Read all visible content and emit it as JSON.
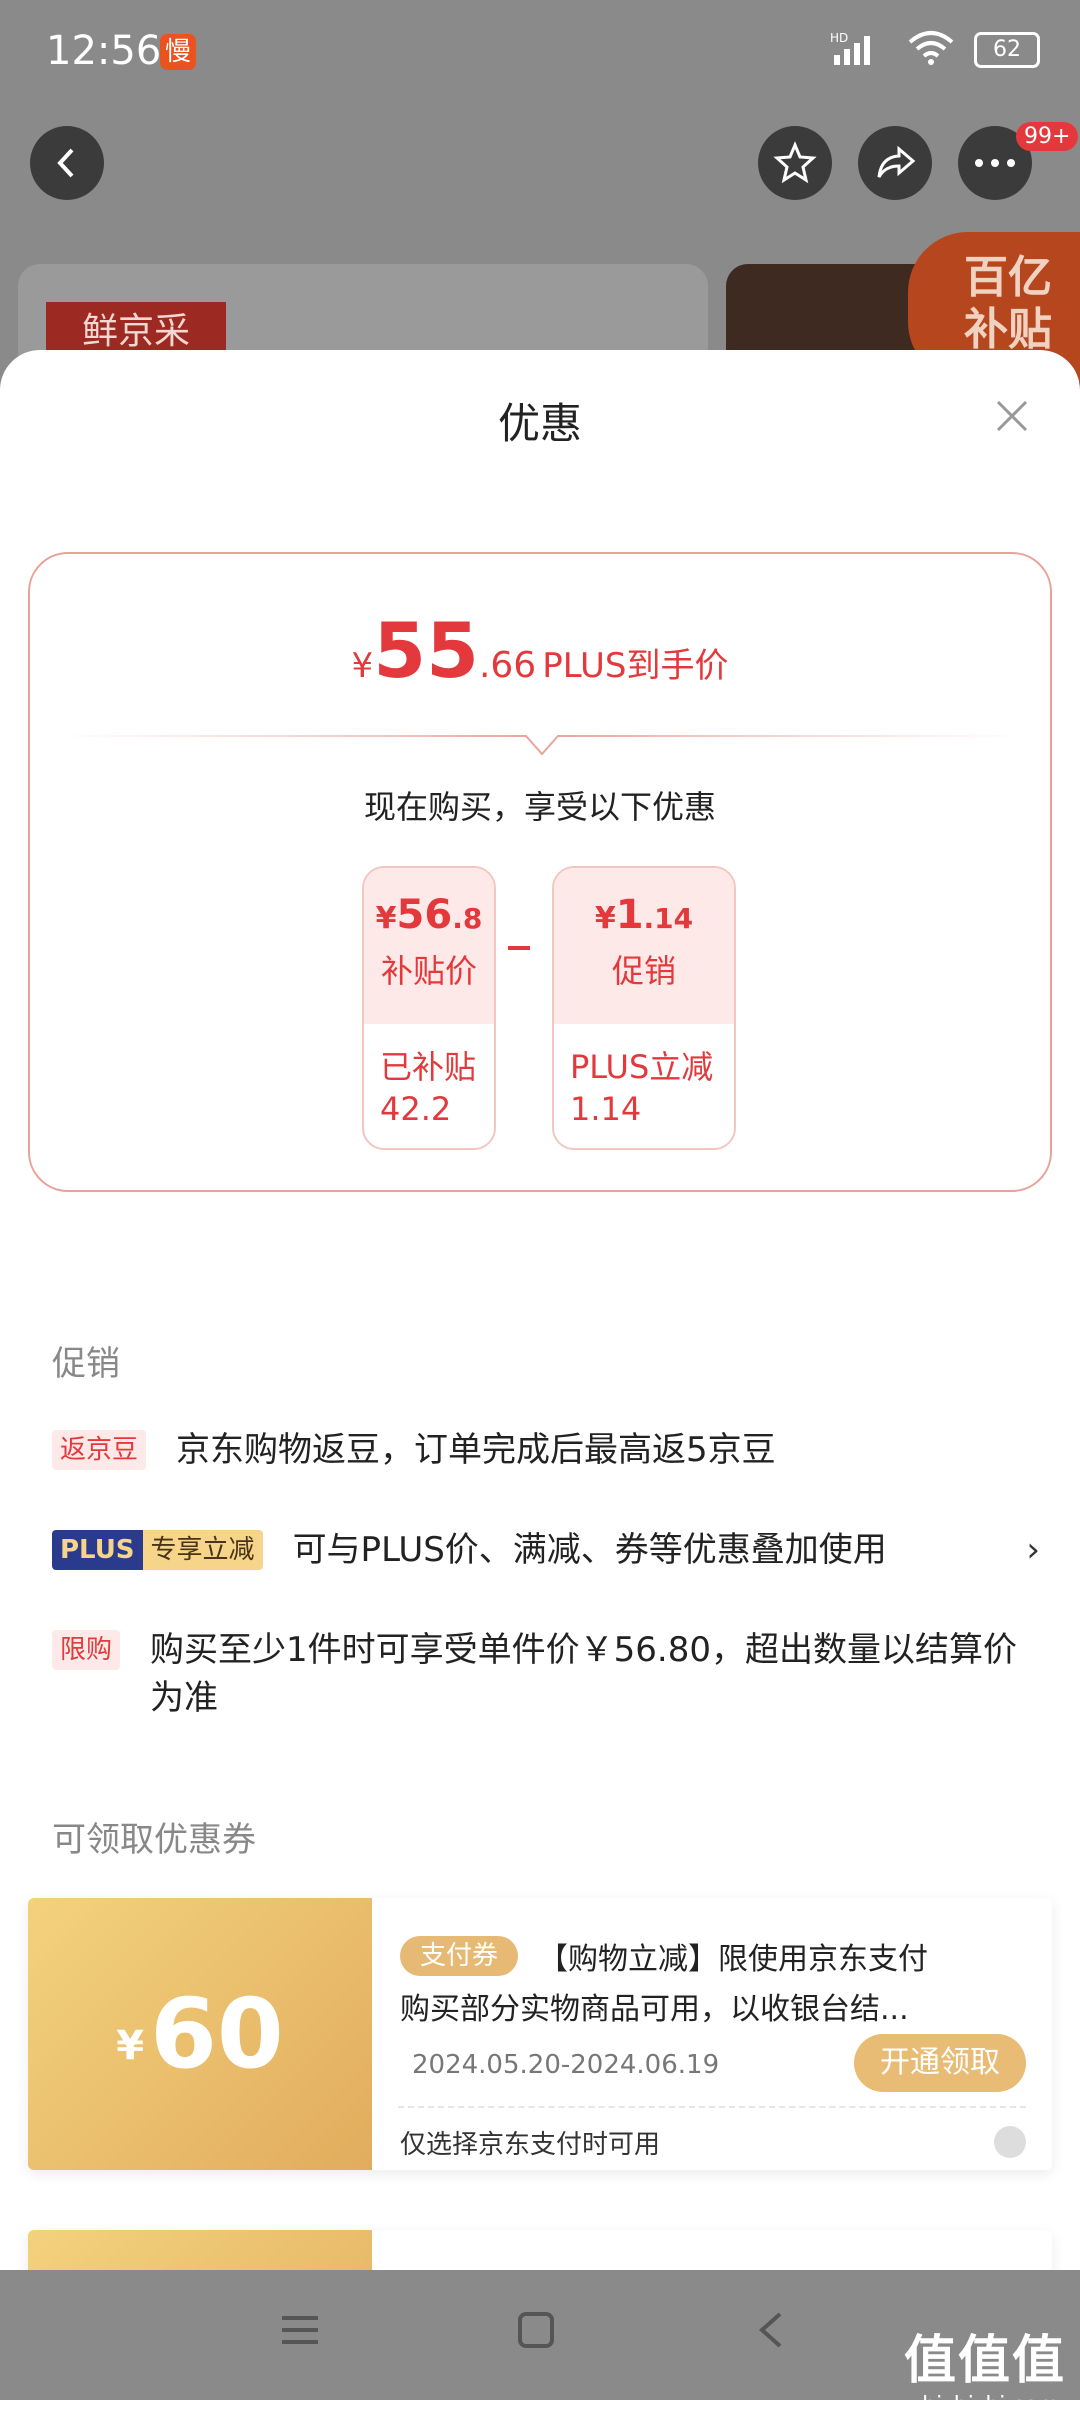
{
  "status_bar": {
    "time": "12:56",
    "slow_badge": "慢",
    "network": "HD",
    "battery": "62"
  },
  "top_bar": {
    "more_badge": "99+"
  },
  "background": {
    "left_tag": "鲜京采",
    "right_badge_line1": "百亿",
    "right_badge_line2": "补贴"
  },
  "sheet": {
    "title": "优惠",
    "price_summary": {
      "yen": "¥",
      "integer": "55",
      "decimal": ".66",
      "label": "PLUS到手价",
      "subtitle": "现在购买，享受以下优惠"
    },
    "breakdown": [
      {
        "yen": "¥",
        "integer": "56",
        "decimal": ".8",
        "label": "补贴价",
        "detail_line1": "已补贴",
        "detail_line2": "42.2"
      },
      {
        "yen": "¥",
        "integer": "1",
        "decimal": ".14",
        "label": "促销",
        "detail_line1": "PLUS立减",
        "detail_line2": "1.14"
      }
    ],
    "promotions": {
      "title": "促销",
      "items": [
        {
          "tag": "返京豆",
          "text": "京东购物返豆，订单完成后最高返5京豆"
        },
        {
          "tag_a": "PLUS",
          "tag_b": "专享立减",
          "text": "可与PLUS价、满减、券等优惠叠加使用"
        },
        {
          "tag": "限购",
          "text": "购买至少1件时可享受单件价￥56.80，超出数量以结算价为准"
        }
      ]
    },
    "coupons": {
      "title": "可领取优惠券",
      "items": [
        {
          "yen": "¥",
          "amount": "60",
          "tag": "支付券",
          "title": "【购物立减】限使用京东支付",
          "desc": "购买部分实物商品可用，以收银台结...",
          "date": "2024.05.20-2024.06.19",
          "button": "开通领取",
          "note": "仅选择京东支付时可用"
        }
      ]
    }
  },
  "watermark": {
    "line1": "值值值",
    "line2": "zhizhizhi.com"
  },
  "colors": {
    "accent_red": "#e4393c",
    "coupon_gold": "#e8bc74",
    "plus_navy": "#2a3a8c"
  }
}
